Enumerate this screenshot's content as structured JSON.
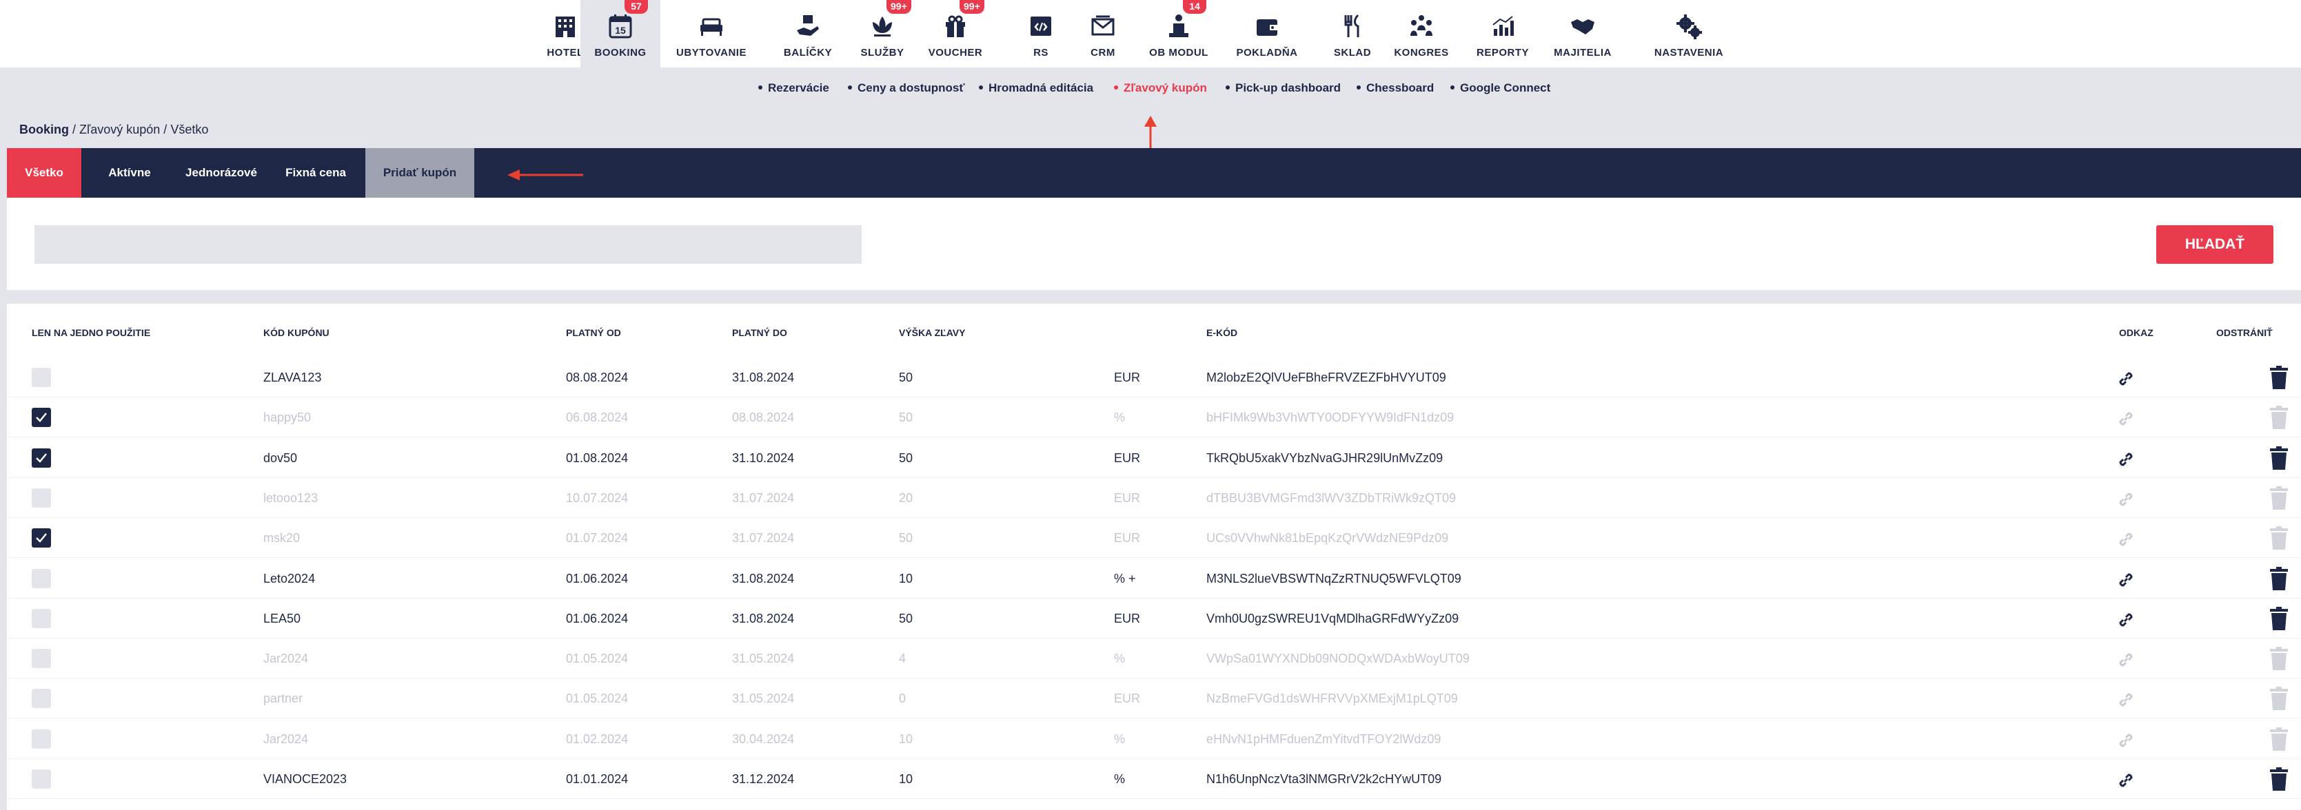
{
  "nav": {
    "items": [
      {
        "label": "HOTEL",
        "icon": "hotel-building-icon",
        "badge": ""
      },
      {
        "label": "BOOKING",
        "icon": "calendar-15-icon",
        "badge": "57"
      },
      {
        "label": "UBYTOVANIE",
        "icon": "bed-icon",
        "badge": ""
      },
      {
        "label": "BALÍČKY",
        "icon": "package-hand-icon",
        "badge": ""
      },
      {
        "label": "SLUŽBY",
        "icon": "lotus-icon",
        "badge": "99+"
      },
      {
        "label": "VOUCHER",
        "icon": "gift-icon",
        "badge": "99+"
      },
      {
        "label": "RS",
        "icon": "code-window-icon",
        "badge": ""
      },
      {
        "label": "CRM",
        "icon": "envelope-icon",
        "badge": ""
      },
      {
        "label": "OB MODUL",
        "icon": "person-hotel-icon",
        "badge": "14"
      },
      {
        "label": "POKLADŇA",
        "icon": "wallet-icon",
        "badge": ""
      },
      {
        "label": "SKLAD",
        "icon": "cutlery-icon",
        "badge": ""
      },
      {
        "label": "KONGRES",
        "icon": "people-group-icon",
        "badge": ""
      },
      {
        "label": "REPORTY",
        "icon": "bar-chart-icon",
        "badge": ""
      },
      {
        "label": "MAJITELIA",
        "icon": "handshake-icon",
        "badge": ""
      },
      {
        "label": "NASTAVENIA",
        "icon": "gears-icon",
        "badge": ""
      }
    ]
  },
  "subnav": {
    "items": [
      "Rezervácie",
      "Ceny a dostupnosť",
      "Hromadná editácia",
      "Zľavový kupón",
      "Pick-up dashboard",
      "Chessboard",
      "Google Connect"
    ]
  },
  "breadcrumb": {
    "root": "Booking",
    "rest": " / Zľavový kupón / Všetko"
  },
  "tabs": [
    "Všetko",
    "Aktívne",
    "Jednorázové",
    "Fixná cena",
    "Pridať kupón"
  ],
  "search": {
    "value": "",
    "placeholder": "",
    "button": "HĽADAŤ"
  },
  "table": {
    "headers": {
      "single_use": "LEN NA JEDNO POUŽITIE",
      "code": "KÓD KUPÓNU",
      "valid_from": "PLATNÝ OD",
      "valid_to": "PLATNÝ DO",
      "discount": "VÝŠKA ZĽAVY",
      "ecode": "E-KÓD",
      "link": "ODKAZ",
      "delete": "ODSTRÁNIŤ"
    },
    "rows": [
      {
        "checked": false,
        "active": true,
        "code": "ZLAVA123",
        "from": "08.08.2024",
        "to": "31.08.2024",
        "amount": "50",
        "unit": "EUR",
        "ecode": "M2lobzE2QlVUeFBheFRVZEZFbHVYUT09"
      },
      {
        "checked": true,
        "active": false,
        "code": "happy50",
        "from": "06.08.2024",
        "to": "08.08.2024",
        "amount": "50",
        "unit": "%",
        "ecode": "bHFIMk9Wb3VhWTY0ODFYYW9IdFN1dz09"
      },
      {
        "checked": true,
        "active": true,
        "code": "dov50",
        "from": "01.08.2024",
        "to": "31.10.2024",
        "amount": "50",
        "unit": "EUR",
        "ecode": "TkRQbU5xakVYbzNvaGJHR29lUnMvZz09"
      },
      {
        "checked": false,
        "active": false,
        "code": "letooo123",
        "from": "10.07.2024",
        "to": "31.07.2024",
        "amount": "20",
        "unit": "EUR",
        "ecode": "dTBBU3BVMGFmd3lWV3ZDbTRiWk9zQT09"
      },
      {
        "checked": true,
        "active": false,
        "code": "msk20",
        "from": "01.07.2024",
        "to": "31.07.2024",
        "amount": "50",
        "unit": "EUR",
        "ecode": "UCs0VVhwNk81bEpqKzQrVWdzNE9Pdz09"
      },
      {
        "checked": false,
        "active": true,
        "code": "Leto2024",
        "from": "01.06.2024",
        "to": "31.08.2024",
        "amount": "10",
        "unit": "% +",
        "ecode": "M3NLS2lueVBSWTNqZzRTNUQ5WFVLQT09"
      },
      {
        "checked": false,
        "active": true,
        "code": "LEA50",
        "from": "01.06.2024",
        "to": "31.08.2024",
        "amount": "50",
        "unit": "EUR",
        "ecode": "Vmh0U0gzSWREU1VqMDlhaGRFdWYyZz09"
      },
      {
        "checked": false,
        "active": false,
        "code": "Jar2024",
        "from": "01.05.2024",
        "to": "31.05.2024",
        "amount": "4",
        "unit": "%",
        "ecode": "VWpSa01WYXNDb09NODQxWDAxbWoyUT09"
      },
      {
        "checked": false,
        "active": false,
        "code": "partner",
        "from": "01.05.2024",
        "to": "31.05.2024",
        "amount": "0",
        "unit": "EUR",
        "ecode": "NzBmeFVGd1dsWHFRVVpXMExjM1pLQT09"
      },
      {
        "checked": false,
        "active": false,
        "code": "Jar2024",
        "from": "01.02.2024",
        "to": "30.04.2024",
        "amount": "10",
        "unit": "%",
        "ecode": "eHNvN1pHMFduenZmYitvdTFOY2lWdz09"
      },
      {
        "checked": false,
        "active": true,
        "code": "VIANOCE2023",
        "from": "01.01.2024",
        "to": "31.12.2024",
        "amount": "10",
        "unit": "%",
        "ecode": "N1h6UnpNczVta3lNMGRrV2k2cHYwUT09"
      }
    ]
  },
  "colors": {
    "navy": "#1f2747",
    "accent": "#ea3a4e",
    "gray": "#e4e5ea",
    "muted": "#c3c6d0"
  }
}
